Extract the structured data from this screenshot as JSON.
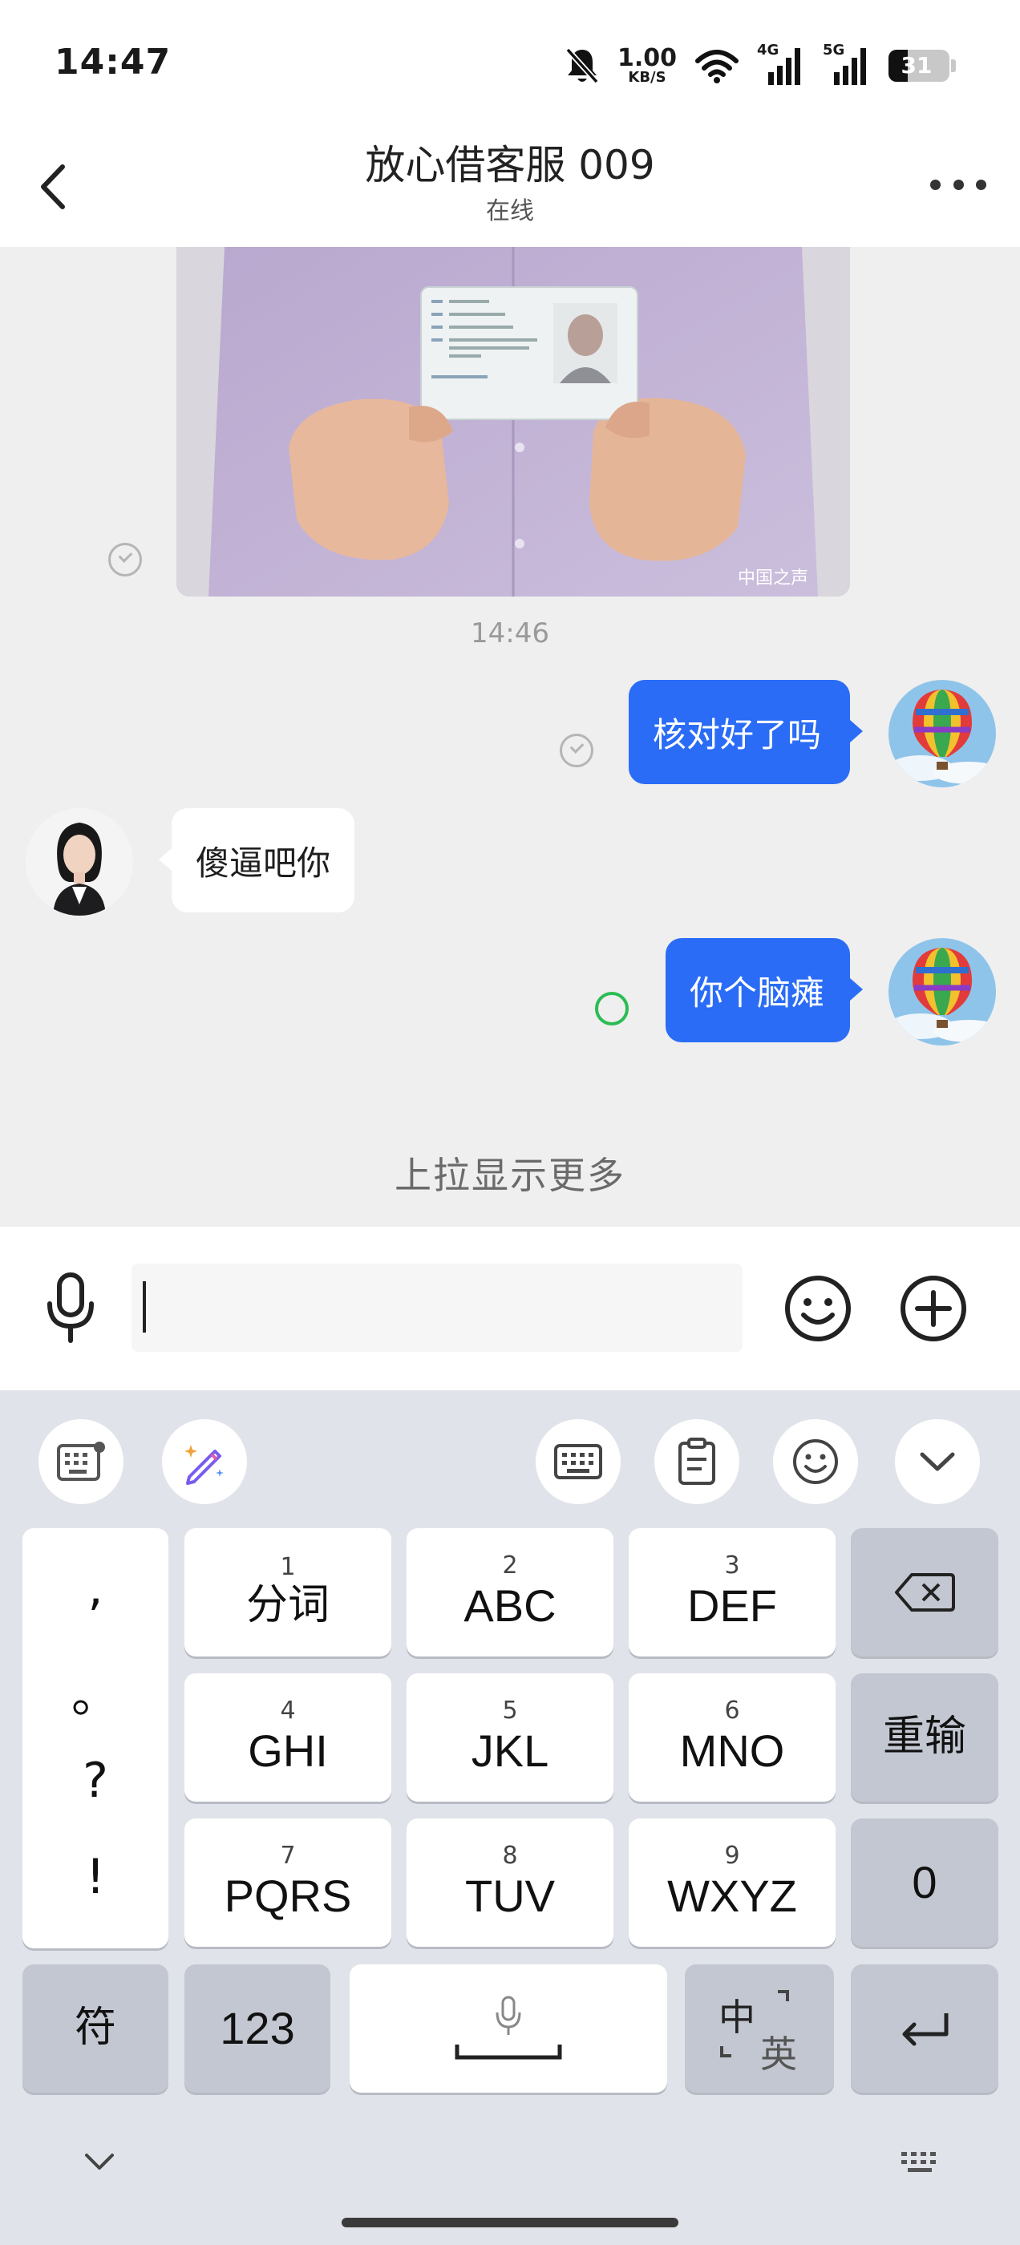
{
  "status_bar": {
    "time": "14:47",
    "speed_value": "1.00",
    "speed_unit": "KB/S",
    "network1": "4G",
    "network2": "5G",
    "battery": "31",
    "icons": [
      "mute-bell-icon",
      "wifi-icon",
      "signal-icon",
      "battery-icon"
    ]
  },
  "header": {
    "title": "放心借客服 009",
    "subtitle": "在线"
  },
  "messages": {
    "timestamp": "14:46",
    "out1": "核对好了吗",
    "in1": "傻逼吧你",
    "out2": "你个脑瘫",
    "pull_more": "上拉显示更多",
    "watermark": "中国之声"
  },
  "input": {
    "value": "",
    "placeholder": ""
  },
  "keyboard": {
    "punct": [
      ",",
      "。",
      "?",
      "!"
    ],
    "keys": [
      {
        "num": "1",
        "label": "分词"
      },
      {
        "num": "2",
        "label": "ABC"
      },
      {
        "num": "3",
        "label": "DEF"
      },
      {
        "num": "4",
        "label": "GHI"
      },
      {
        "num": "5",
        "label": "JKL"
      },
      {
        "num": "6",
        "label": "MNO"
      },
      {
        "num": "7",
        "label": "PQRS"
      },
      {
        "num": "8",
        "label": "TUV"
      },
      {
        "num": "9",
        "label": "WXYZ"
      }
    ],
    "reenter": "重输",
    "zero": "0",
    "symbol": "符",
    "numeric": "123",
    "lang_zh": "中",
    "lang_en": "英"
  },
  "colors": {
    "accent_blue": "#2a6cf6",
    "chat_bg": "#efefef",
    "keyboard_bg": "#e1e3ea",
    "sending_green": "#2cbc55"
  }
}
